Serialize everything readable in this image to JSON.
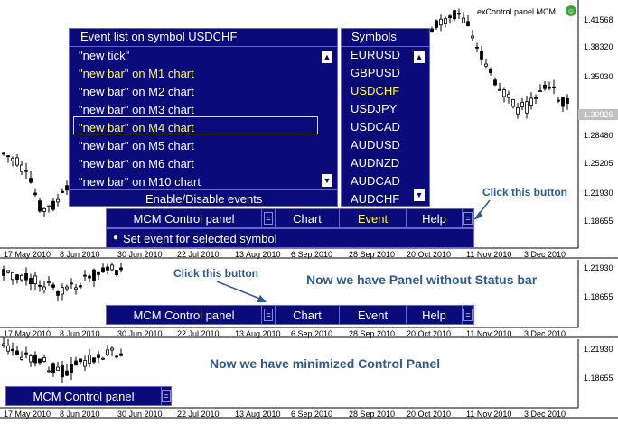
{
  "top": {
    "app_label": "exControl panel MCM"
  },
  "event_panel": {
    "title": "Event list on symbol USDCHF",
    "items": [
      "\"new tick\"",
      "\"new bar\" on M1 chart",
      "\"new bar\" on M2 chart",
      "\"new bar\" on M3 chart",
      "\"new bar\" on M4 chart",
      "\"new bar\" on M5 chart",
      "\"new bar\" on M6 chart",
      "\"new bar\" on M10 chart"
    ],
    "highlighted": [
      1,
      4
    ],
    "footer": "Enable/Disable events"
  },
  "symbols_panel": {
    "title": "Symbols",
    "items": [
      "EURUSD",
      "GBPUSD",
      "USDCHF",
      "USDJPY",
      "USDCAD",
      "AUDUSD",
      "AUDNZD",
      "AUDCAD",
      "AUDCHF"
    ],
    "selected": 2
  },
  "control": {
    "label": "MCM Control panel",
    "chart": "Chart",
    "event": "Event",
    "help": "Help",
    "status": "Set event for selected symbol"
  },
  "annotations": {
    "click1": "Click this button",
    "click2": "Click this button",
    "no_status": "Now we have Panel without Status bar",
    "minimized": "Now we have minimized Control Panel"
  },
  "chart1": {
    "price_labels": [
      "1.41568",
      "1.38320",
      "1.35030",
      "1.30926",
      "1.28480",
      "1.25205",
      "1.21930",
      "1.18655"
    ]
  },
  "chart2": {
    "price_labels": [
      "1.21930",
      "1.18655"
    ]
  },
  "chart3": {
    "price_labels": [
      "1.21930",
      "1.18655"
    ]
  },
  "dates": [
    "17 May 2010",
    "8 Jun 2010",
    "30 Jun 2010",
    "22 Jul 2010",
    "13 Aug 2010",
    "6 Sep 2010",
    "28 Sep 2010",
    "20 Oct 2010",
    "11 Nov 2010",
    "3 Dec 2010"
  ],
  "colors": {
    "panel_bg": "#0a0a7a",
    "highlight": "#ffff33",
    "annotation": "#2e5a8e"
  }
}
